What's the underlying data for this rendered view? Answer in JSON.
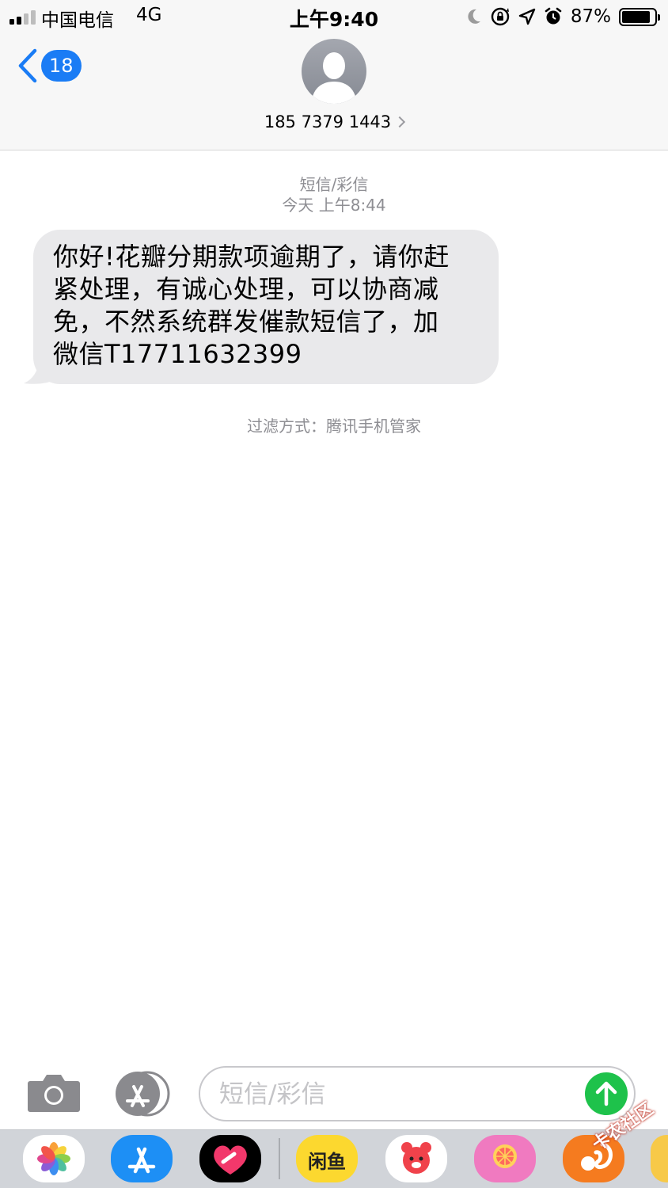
{
  "status_bar": {
    "carrier": "中国电信",
    "network": "4G",
    "time": "上午9:40",
    "battery_percent": "87%",
    "battery_level": 0.87,
    "icons": [
      "moon-icon",
      "orientation-lock-icon",
      "location-icon",
      "alarm-icon"
    ]
  },
  "header": {
    "back_badge": "18",
    "contact_name": "185 7379 1443"
  },
  "conversation": {
    "message_type": "短信/彩信",
    "timestamp": "今天 上午8:44",
    "message": {
      "lines": [
        "你好!花瓣分期款项逾期了，请你赶",
        "紧处理，有诚心处理，可以协商减",
        "免，不然系统群发催款短信了，加",
        "微信T17711632399"
      ]
    },
    "filter_note": "过滤方式：腾讯手机管家"
  },
  "input_bar": {
    "placeholder": "短信/彩信"
  },
  "app_drawer": {
    "apps": [
      "photos-app-icon",
      "app-store-icon",
      "digital-touch-icon",
      "xianyu-app-icon",
      "bear-app-icon",
      "grapefruit-app-icon",
      "squirrel-app-icon"
    ],
    "xianyu_label": "闲鱼"
  },
  "watermark": "卡农社区",
  "colors": {
    "accent_blue": "#1a7cf5",
    "send_green": "#1ec24b",
    "bubble_gray": "#e9e9eb",
    "meta_gray": "#8e8e93"
  }
}
